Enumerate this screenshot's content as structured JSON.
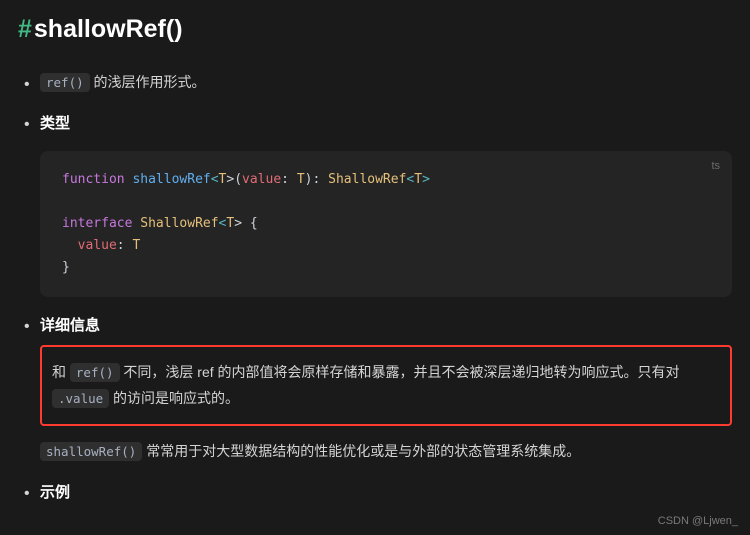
{
  "heading": {
    "anchor": "#",
    "title": "shallowRef()"
  },
  "intro": {
    "code": "ref()",
    "text": " 的浅层作用形式。"
  },
  "sections": {
    "type_title": "类型",
    "details_title": "详细信息",
    "example_title": "示例"
  },
  "typeblock": {
    "lang": "ts",
    "l1": {
      "kw": "function",
      "fn": " shallowRef",
      "g1": "<",
      "t1": "T",
      "g2": ">(",
      "param": "value",
      "colon": ": ",
      "pt": "T",
      "g3": "): ",
      "rt": "ShallowRef",
      "g4": "<",
      "t2": "T",
      "g5": ">"
    },
    "l2": {
      "kw": "interface",
      "name": " ShallowRef",
      "g1": "<",
      "t": "T",
      "g2": "> {"
    },
    "l3": {
      "indent": "  ",
      "prop": "value",
      "colon": ": ",
      "t": "T"
    },
    "l4": "}"
  },
  "details": {
    "p1_a": "和 ",
    "p1_code1": "ref()",
    "p1_b": " 不同，浅层 ref 的内部值将会原样存储和暴露，并且不会被深层递归地转为响应式。只有对 ",
    "p1_code2": ".value",
    "p1_c": " 的访问是响应式的。",
    "p2_code": "shallowRef()",
    "p2_text": " 常常用于对大型数据结构的性能优化或是与外部的状态管理系统集成。"
  },
  "watermark": "CSDN @Ljwen_"
}
